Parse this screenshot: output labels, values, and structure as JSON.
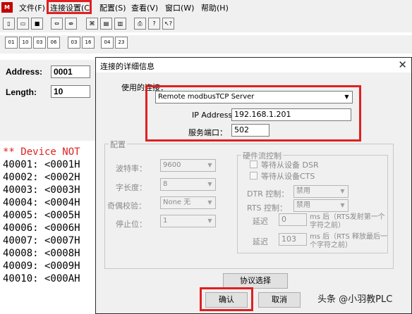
{
  "menubar": {
    "items": [
      "文件(F)",
      "连接设置(C",
      "配置(S)",
      "查看(V)",
      "窗口(W)",
      "帮助(H)"
    ]
  },
  "toolbar1": {
    "icons": [
      "new-doc-icon",
      "open-folder-icon",
      "save-icon",
      "connect-icon",
      "disconnect-icon",
      "network-icon",
      "read-icon",
      "write-icon",
      "print-icon",
      "help-icon",
      "context-help-icon"
    ]
  },
  "toolbar2": {
    "labels": [
      "01",
      "10",
      "03",
      "06",
      "03",
      "16",
      "04",
      "23"
    ]
  },
  "left_panel": {
    "address_label": "Address:",
    "address_value": "0001",
    "length_label": "Length:",
    "length_value": "10"
  },
  "registers": {
    "error_line": "** Device NOT",
    "lines": [
      "40001: <0001H",
      "40002: <0002H",
      "40003: <0003H",
      "40004: <0004H",
      "40005: <0005H",
      "40006: <0006H",
      "40007: <0007H",
      "40008: <0008H",
      "40009: <0009H",
      "40010: <000AH"
    ]
  },
  "dialog": {
    "title": "连接的详细信息",
    "connection_label": "使用的连接：",
    "connection_value": "Remote modbusTCP Server",
    "ip_label": "IP Address:",
    "ip_value": "192.168.1.201",
    "port_label": "服务端口：",
    "port_value": "502",
    "config_group": "配置",
    "baud_label": "波特率：",
    "baud_value": "9600",
    "wordlen_label": "字长度：",
    "wordlen_value": "8",
    "parity_label": "奇偶校验：",
    "parity_value": "None 无",
    "stop_label": "停止位：",
    "stop_value": "1",
    "hw_group": "硬件流控制",
    "dsr_label": "等待从设备 DSR",
    "cts_label": "等待从设备CTS",
    "dtr_label": "DTR 控制：",
    "dtr_value": "禁用",
    "rts_label": "RTS 控制：",
    "rts_value": "禁用",
    "delay1_label": "延迟",
    "delay1_value": "0",
    "delay1_note": "ms 后（RTS发射第一个字符之前）",
    "delay2_label": "延迟",
    "delay2_value": "103",
    "delay2_note": "ms 后（RTS 释放最后一个字符之前）",
    "protocol_button": "协议选择",
    "ok_button": "确认",
    "cancel_button": "取消",
    "close_symbol": "✕"
  },
  "watermark": "头条 @小羽教PLC",
  "colors": {
    "highlight_red": "#e02020",
    "error_red": "#e02020"
  }
}
